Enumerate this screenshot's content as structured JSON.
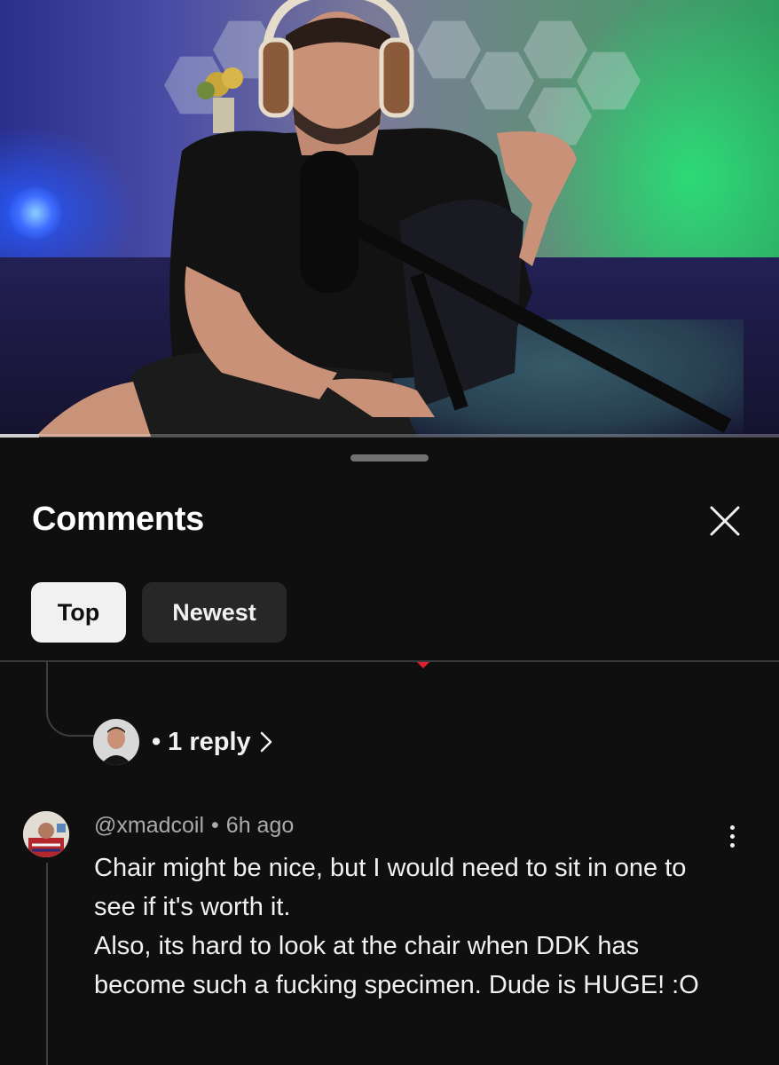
{
  "video": {
    "thumbnail": "man-with-headphones-at-microphone",
    "progress_fraction": 0.05
  },
  "sheet": {
    "title": "Comments",
    "close_icon": "close-icon"
  },
  "sort_chips": [
    {
      "label": "Top",
      "active": true
    },
    {
      "label": "Newest",
      "active": false
    }
  ],
  "thread": {
    "reply_separator": "•",
    "reply_count_label": "1 reply",
    "reply_chevron_icon": "chevron-right-icon"
  },
  "comment": {
    "author": "@xmadcoil",
    "separator": "•",
    "time": "6h ago",
    "body_lines": [
      "Chair might be nice, but I would need to sit in one to see if it's worth it.",
      "Also, its hard to look at the chair when DDK has become such a fucking specimen. Dude is HUGE! :O"
    ],
    "more_icon": "more-vertical-icon"
  },
  "colors": {
    "background": "#0f0f0f",
    "chip_active": "#f1f1f1",
    "chip_idle": "#272727",
    "meta_text": "#aaaaaa",
    "accent_red": "#e0202e"
  }
}
